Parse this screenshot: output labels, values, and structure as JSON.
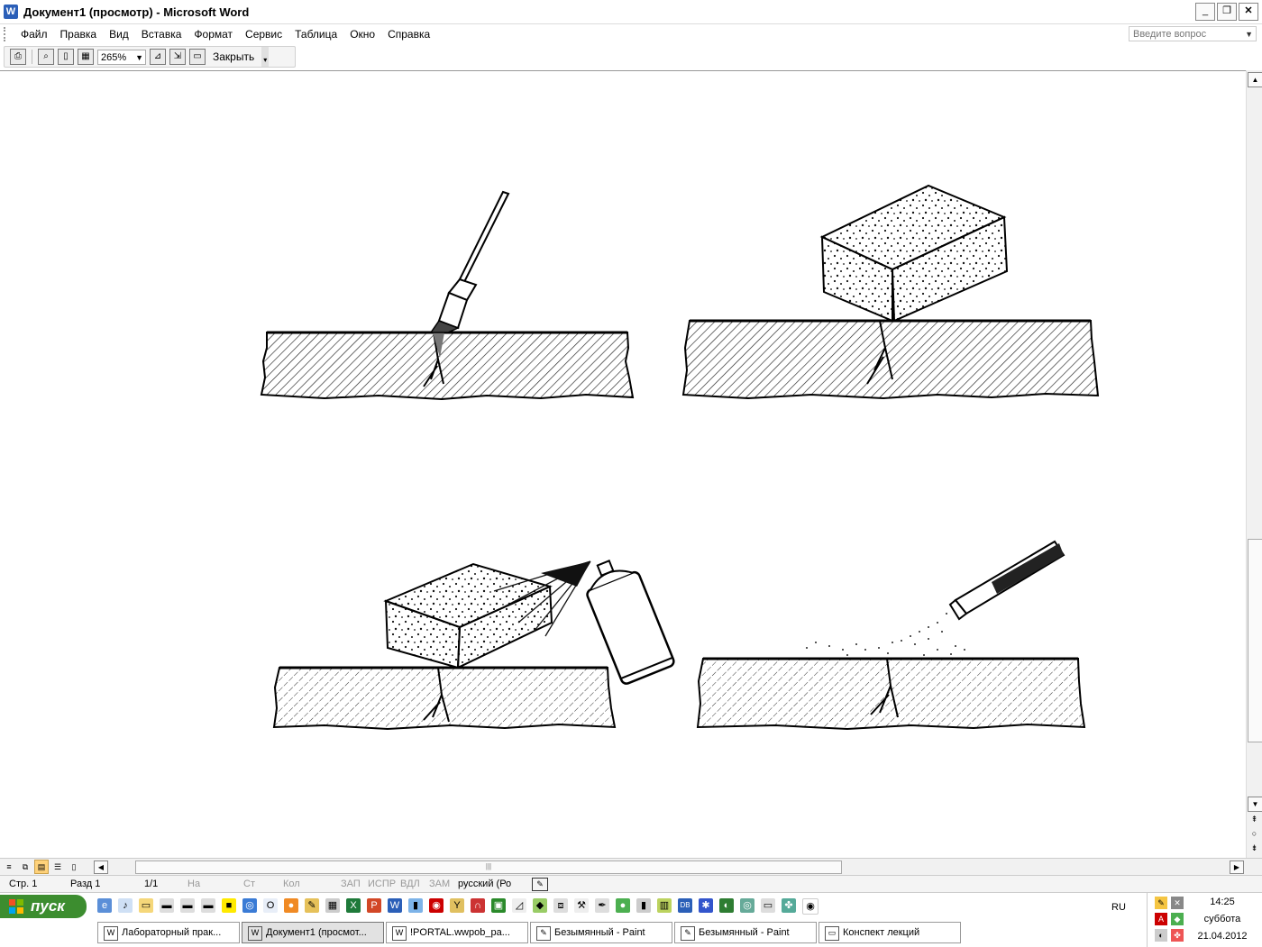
{
  "window": {
    "title": "Документ1 (просмотр) - Microsoft Word",
    "app_icon": "W",
    "controls": {
      "minimize": "_",
      "maximize": "❐",
      "close": "✕"
    }
  },
  "menu": {
    "items": [
      "Файл",
      "Правка",
      "Вид",
      "Вставка",
      "Формат",
      "Сервис",
      "Таблица",
      "Окно",
      "Справка"
    ],
    "help_placeholder": "Введите вопрос"
  },
  "toolbar": {
    "zoom": "265%",
    "close_label": "Закрыть"
  },
  "statusbar": {
    "page": "Стр. 1",
    "section": "Разд 1",
    "pages": "1/1",
    "at": "На",
    "line": "Ст",
    "col": "Кол",
    "rec": "ЗАП",
    "trk": "ИСПР",
    "ext": "ВДЛ",
    "ovr": "ЗАМ",
    "language": "русский (Ро"
  },
  "taskbar": {
    "start_label": "пуск",
    "windows": [
      "Лабораторный прак...",
      "Документ1 (просмот...",
      "!PORTAL.wwpob_pa...",
      "Безымянный - Paint",
      "Безымянный - Paint",
      "Конспект лекций"
    ],
    "language": "RU",
    "clock": {
      "time": "14:25",
      "day": "суббота",
      "date": "21.04.2012"
    }
  },
  "colors": {
    "start_green": "#3c8d2f",
    "word_blue": "#2b5fb8",
    "active_view": "#ffd27a"
  },
  "document": {
    "figures": [
      "brush-applying-to-crack",
      "sponge-block-on-crack",
      "spray-can-and-block-on-crack",
      "spray-gun-on-crack"
    ]
  }
}
